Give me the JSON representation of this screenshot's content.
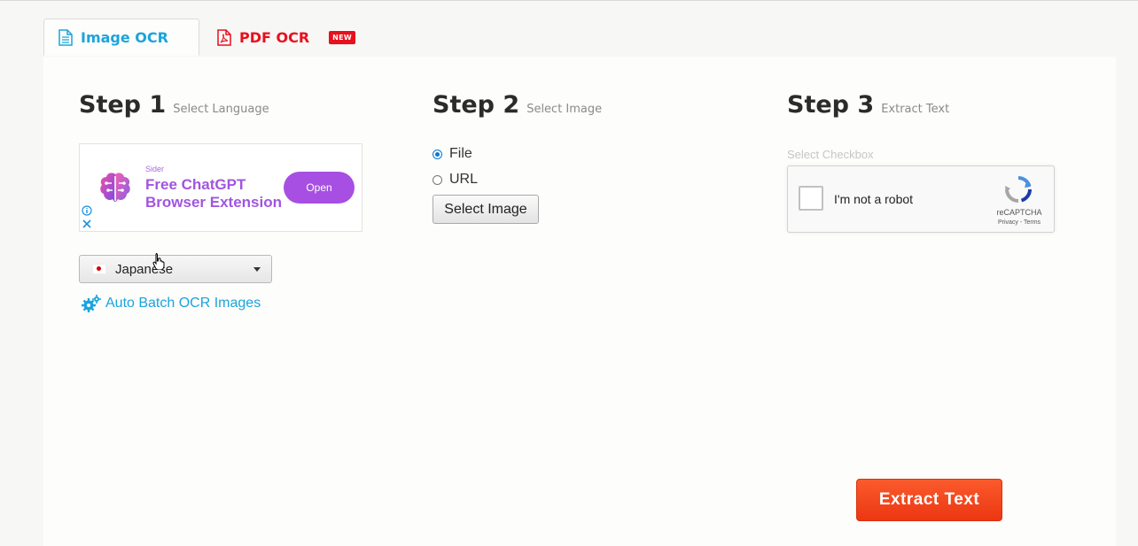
{
  "tabs": [
    {
      "label": "Image OCR",
      "icon": "document-icon",
      "active": true
    },
    {
      "label": "PDF OCR",
      "icon": "pdf-icon",
      "badge": "NEW",
      "active": false
    }
  ],
  "steps": [
    {
      "title": "Step 1",
      "subtitle": "Select Language"
    },
    {
      "title": "Step 2",
      "subtitle": "Select Image"
    },
    {
      "title": "Step 3",
      "subtitle": "Extract Text"
    }
  ],
  "ad": {
    "brand": "Sider",
    "headline": "Free ChatGPT Browser Extension",
    "cta": "Open",
    "accent": "#a155e0"
  },
  "language": {
    "selected": "Japanese",
    "flag": "japan-flag-icon"
  },
  "batch_link": {
    "label": "Auto Batch OCR Images",
    "icon": "gears-icon"
  },
  "source": {
    "options": [
      {
        "label": "File",
        "checked": true
      },
      {
        "label": "URL",
        "checked": false
      }
    ],
    "button": "Select Image"
  },
  "captcha": {
    "hint": "Select Checkbox",
    "label": "I'm not a robot",
    "brand": "reCAPTCHA",
    "links": "Privacy - Terms"
  },
  "extract_button": "Extract Text",
  "colors": {
    "accent_blue": "#1ba4dd",
    "pdf_red": "#e8101d",
    "extract_orange": "#f54a1f"
  }
}
